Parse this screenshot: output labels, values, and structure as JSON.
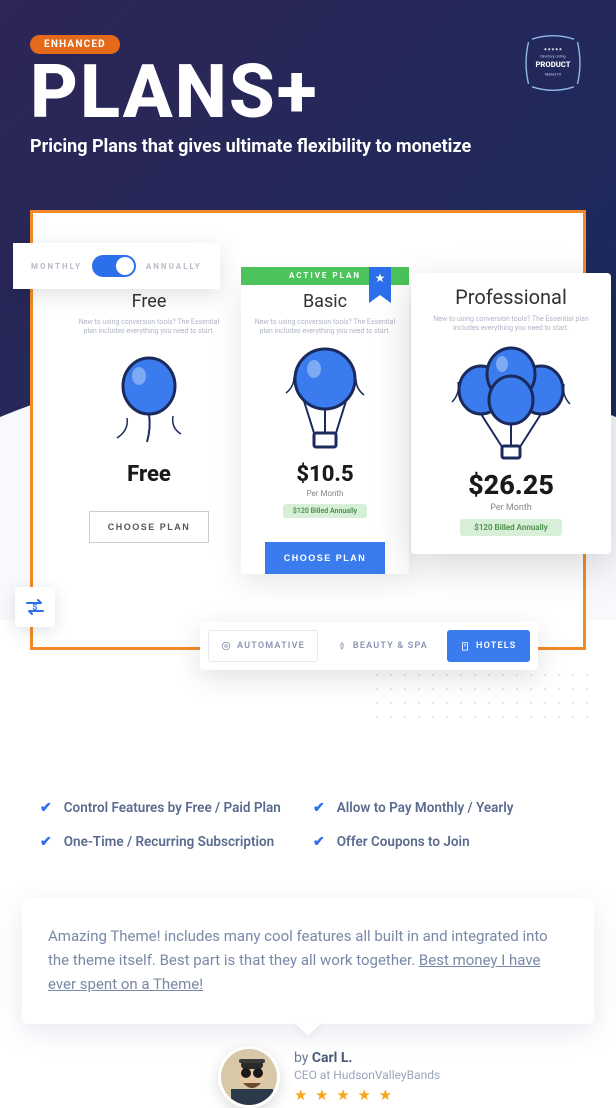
{
  "hero": {
    "badge": "ENHANCED",
    "title": "PLANS+",
    "subtitle": "Pricing Plans that gives ultimate flexibility to monetize"
  },
  "product_badge": {
    "line1": "Directory Listing",
    "line2": "PRODUCT",
    "line3": "Market Fit"
  },
  "toggle": {
    "monthly": "MONTHLY",
    "annually": "ANNUALLY"
  },
  "plans": {
    "free": {
      "name": "Free",
      "desc": "New to using conversion tools? The Essential plan includes everything you need to start.",
      "price": "Free",
      "cta": "CHOOSE PLAN"
    },
    "basic": {
      "ribbon": "ACTIVE PLAN",
      "name": "Basic",
      "desc": "New to using conversion tools? The Essential plan includes everything you need to start.",
      "price": "$10.5",
      "period": "Per Month",
      "billed": "$120 Billed Annually",
      "cta": "CHOOSE PLAN"
    },
    "pro": {
      "name": "Professional",
      "desc": "New to using conversion tools? The Essential plan includes everything you need to start.",
      "price": "$26.25",
      "period": "Per Month",
      "billed": "$120 Billed Annually"
    }
  },
  "categories": {
    "automative": "AUTOMATIVE",
    "beauty": "BEAUTY & SPA",
    "hotels": "HOTELS"
  },
  "features": {
    "a": "Control Features by Free / Paid Plan",
    "b": "Allow to Pay Monthly / Yearly",
    "c": "One-Time / Recurring Subscription",
    "d": "Offer Coupons to Join"
  },
  "testimonial": {
    "text_a": "Amazing Theme! includes many cool features all built in and integrated into the theme itself. Best part is that they all work together. ",
    "text_b": "Best money I have ever spent on a Theme! ",
    "by": "by ",
    "name": "Carl L.",
    "role": "CEO at HudsonValleyBands",
    "stars": "★ ★ ★ ★ ★"
  }
}
